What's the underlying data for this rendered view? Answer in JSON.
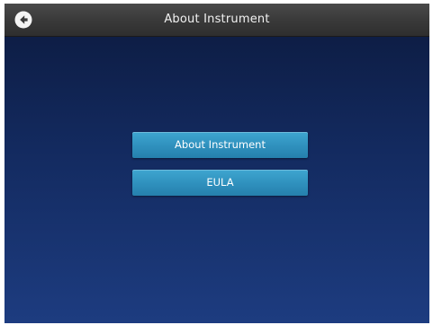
{
  "header": {
    "title": "About Instrument",
    "back_icon": "arrow-left-circle-icon"
  },
  "menu": {
    "buttons": [
      {
        "label": "About Instrument"
      },
      {
        "label": "EULA"
      }
    ]
  },
  "colors": {
    "header_bg": "#3a3a3a",
    "screen_top": "#0c1a3e",
    "screen_bottom": "#1d3c80",
    "button_bg": "#2f90bd",
    "text": "#ffffff"
  }
}
